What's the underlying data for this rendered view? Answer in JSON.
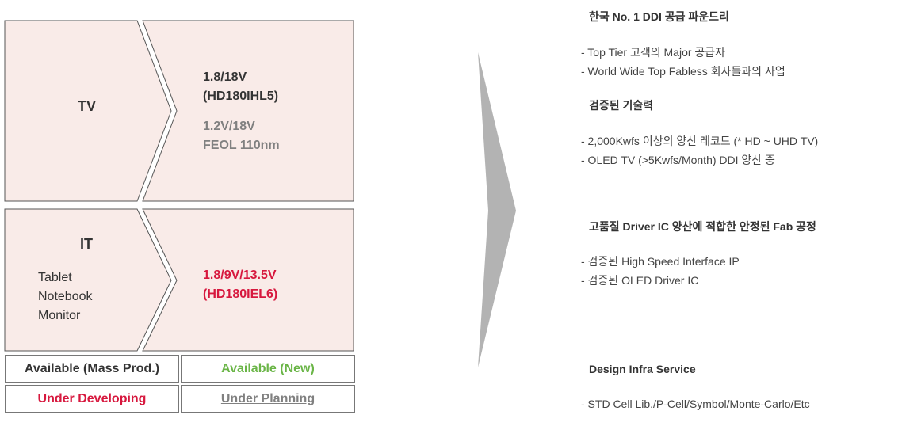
{
  "left": {
    "tv": {
      "category": "TV",
      "spec_primary": [
        "1.8/18V",
        "(HD180IHL5)"
      ],
      "spec_secondary": [
        "1.2V/18V",
        "FEOL 110nm"
      ]
    },
    "it": {
      "category": "IT",
      "applications": [
        "Tablet",
        "Notebook",
        "Monitor"
      ],
      "spec_primary": [
        "1.8/9V/13.5V",
        "(HD180IEL6)"
      ]
    }
  },
  "legend": {
    "mass_prod": "Available (Mass Prod.)",
    "new": "Available (New)",
    "developing": "Under Developing",
    "planning": "Under Planning"
  },
  "right": {
    "sections": [
      {
        "heading": "한국 No. 1 DDI 공급 파운드리",
        "bullets": [
          "- Top Tier 고객의 Major 공급자",
          "- World Wide Top Fabless 회사들과의 사업"
        ]
      },
      {
        "heading": "검증된 기술력",
        "bullets": [
          "- 2,000Kwfs 이상의 양산 레코드 (* HD ~ UHD TV)",
          "- OLED TV (>5Kwfs/Month) DDI 양산 중"
        ]
      },
      {
        "heading": "고품질 Driver IC 양산에 적합한 안정된 Fab 공정",
        "bullets": [
          "- 검증된 High Speed Interface IP",
          "- 검증된 OLED Driver IC"
        ]
      },
      {
        "heading": "Design Infra Service",
        "bullets": [
          "- STD Cell Lib./P-Cell/Symbol/Monte-Carlo/Etc"
        ]
      }
    ]
  },
  "colors": {
    "box_fill": "#f9ebe8",
    "box_stroke": "#555555",
    "new_green": "#6ab547",
    "developing_red": "#d7183e",
    "planning_gray": "#808080",
    "arrow_gray": "#b3b3b3"
  }
}
